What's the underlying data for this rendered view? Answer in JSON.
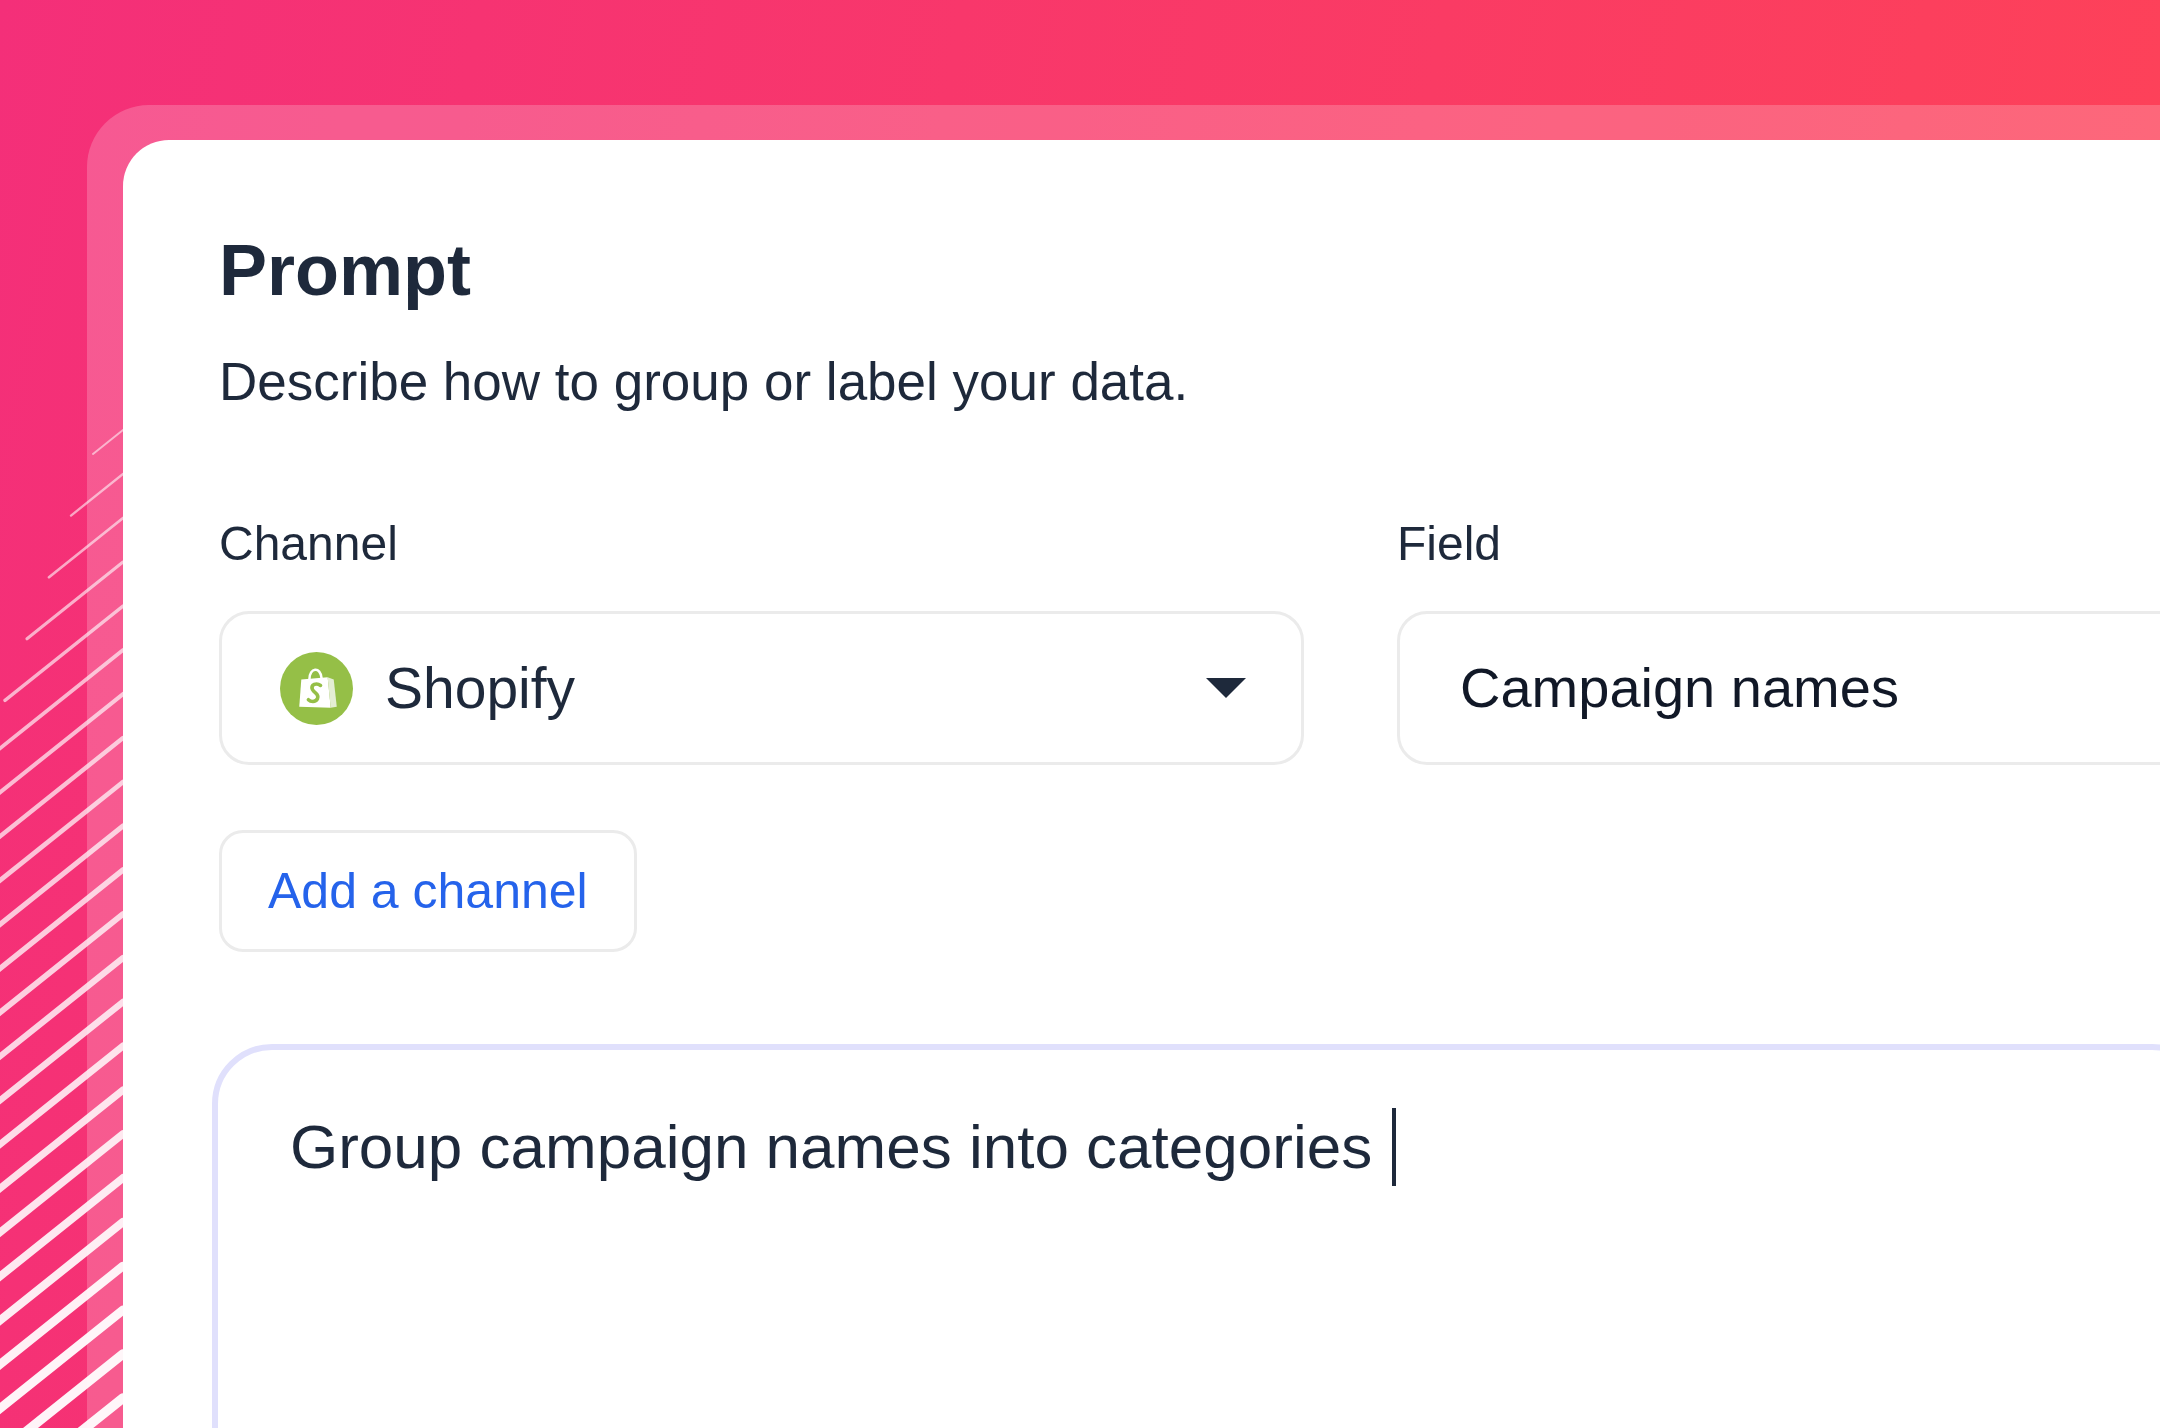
{
  "prompt": {
    "title": "Prompt",
    "description": "Describe how to group or label your data."
  },
  "channel": {
    "label": "Channel",
    "value": "Shopify"
  },
  "field": {
    "label": "Field",
    "value": "Campaign names"
  },
  "add_channel_button": {
    "label": "Add a channel"
  },
  "prompt_input": {
    "value": "Group campaign names into categories",
    "focused": true
  }
}
